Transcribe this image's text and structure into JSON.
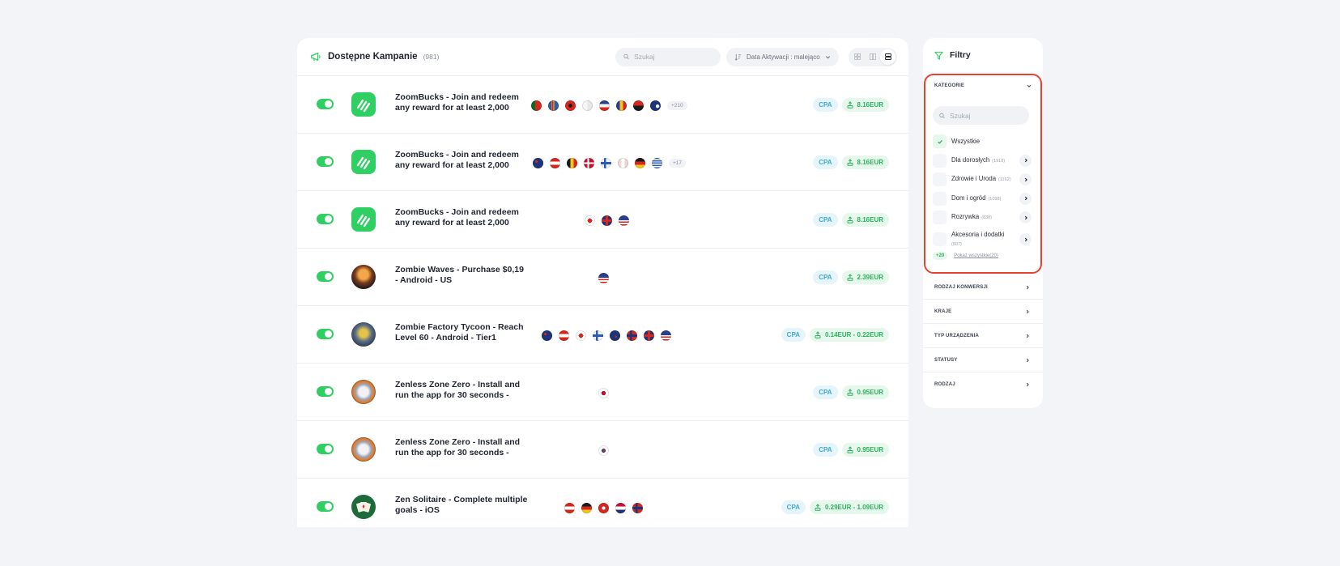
{
  "header": {
    "title": "Dostępne Kampanie",
    "count": "(981)",
    "search_placeholder": "Szukaj",
    "sort_label": "Data Aktywacji : malejąco"
  },
  "campaigns": [
    {
      "title": "ZoomBucks - Join and redeem any reward for at least 2,000",
      "logo": "zoombucks-logo",
      "flags": [
        "portugal",
        "aland",
        "albania",
        "algeria",
        "andorra",
        "romania",
        "angola",
        "anguilla"
      ],
      "more": "+210",
      "type": "CPA",
      "payout": "8.16EUR"
    },
    {
      "title": "ZoomBucks - Join and redeem any reward for at least 2,000",
      "logo": "zoombucks-logo",
      "flags": [
        "australia",
        "austria",
        "belgium",
        "denmark",
        "finland",
        "france",
        "germany",
        "greece"
      ],
      "more": "+17",
      "type": "CPA",
      "payout": "8.16EUR"
    },
    {
      "title": "ZoomBucks - Join and redeem any reward for at least 2,000",
      "logo": "zoombucks-logo",
      "flags": [
        "canada",
        "united-kingdom",
        "united-states"
      ],
      "more": "",
      "type": "CPA",
      "payout": "8.16EUR"
    },
    {
      "title": "Zombie Waves - Purchase $0,19 - Android - US",
      "logo": "zombie-waves-logo",
      "flags": [
        "united-states"
      ],
      "more": "",
      "type": "CPA",
      "payout": "2.39EUR"
    },
    {
      "title": "Zombie Factory Tycoon - Reach Level 60 - Android - Tier1",
      "logo": "zombie-factory-logo",
      "flags": [
        "australia",
        "austria",
        "canada",
        "finland",
        "new-zealand",
        "norway",
        "united-kingdom",
        "united-states"
      ],
      "more": "",
      "type": "CPA",
      "payout": "0.14EUR - 0.22EUR"
    },
    {
      "title": "Zenless Zone Zero - Install and run the app for 30 seconds -",
      "logo": "zenless-logo",
      "flags": [
        "japan"
      ],
      "more": "",
      "type": "CPA",
      "payout": "0.95EUR"
    },
    {
      "title": "Zenless Zone Zero - Install and run the app for 30 seconds -",
      "logo": "zenless-logo",
      "flags": [
        "south-korea"
      ],
      "more": "",
      "type": "CPA",
      "payout": "0.95EUR"
    },
    {
      "title": "Zen Solitaire - Complete multiple goals - iOS",
      "logo": "zen-solitaire-logo",
      "flags": [
        "austria",
        "germany",
        "hong-kong",
        "netherlands",
        "norway"
      ],
      "more": "",
      "type": "CPA",
      "payout": "0.29EUR - 1.09EUR"
    }
  ],
  "filters": {
    "title": "Filtry",
    "categories": {
      "heading": "KATEGORIE",
      "search_placeholder": "Szukaj",
      "items": [
        {
          "label": "Wszystkie",
          "count": "",
          "checked": true
        },
        {
          "label": "Dla dorosłych",
          "count": "(1918)",
          "checked": false
        },
        {
          "label": "Zdrowie i Uroda",
          "count": "(1162)",
          "checked": false
        },
        {
          "label": "Dom i ogród",
          "count": "(1098)",
          "checked": false
        },
        {
          "label": "Rozrywka",
          "count": "(838)",
          "checked": false
        },
        {
          "label": "Akcesoria i dodatki",
          "count": "(807)",
          "checked": false
        }
      ],
      "more_badge": "+20",
      "show_all": "Pokaż wszystkie(20)"
    },
    "sections": [
      "RODZAJ KONWERSJI",
      "KRAJE",
      "TYP URZĄDZENIA",
      "STATUSY",
      "RODZAJ"
    ]
  },
  "colors": {
    "accent_green": "#2fcf63",
    "cpa_blue": "#40a9d6",
    "highlight_red": "#e5432e"
  }
}
